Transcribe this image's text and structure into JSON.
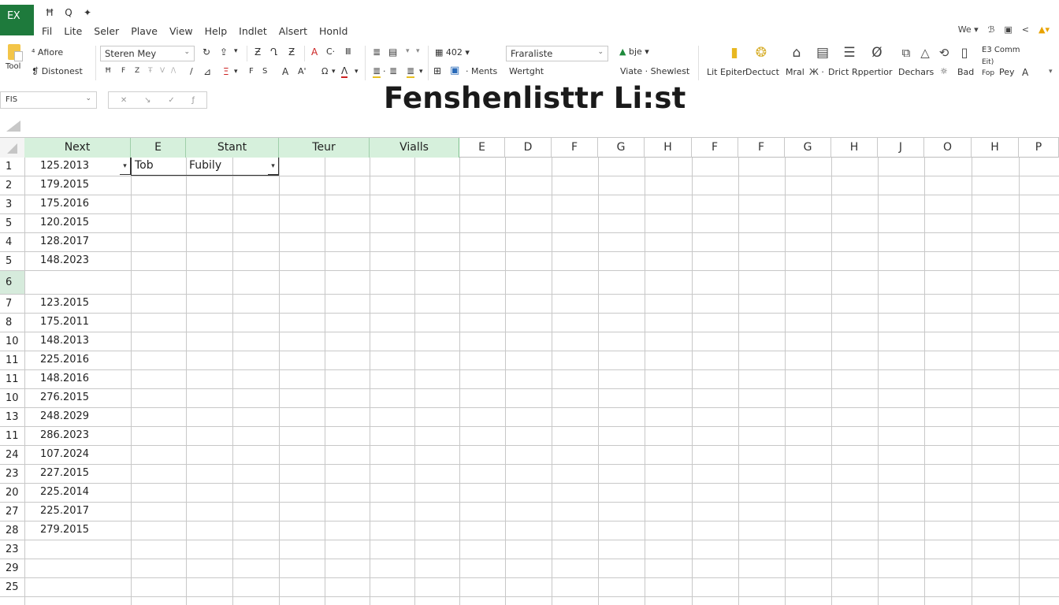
{
  "app": {
    "logo": "EX",
    "quick_access": [
      "save-icon",
      "search-icon",
      "pin-icon"
    ],
    "quick_access_glyphs": [
      "Ħ",
      "Q",
      "✦"
    ]
  },
  "menu": [
    "Fil",
    "Lite",
    "Seler",
    "Plave",
    "View",
    "Help",
    "Indlet",
    "Alsert",
    "Honld"
  ],
  "title_right": {
    "user_label": "We",
    "glyphs": [
      "ℬ",
      "▣",
      "<",
      "▲"
    ]
  },
  "ribbon": {
    "paste_label": "Tool",
    "clipboard": [
      "Afiore",
      "Distonest"
    ],
    "font_name": "Steren Mey",
    "row1_glyphs": [
      "↻",
      "⇪",
      "▾",
      "Ƶ",
      "Ղ",
      "Ƶ",
      "A",
      "C·",
      "Ⅲ"
    ],
    "row2_glyphs": [
      "Ħ",
      "F",
      "Z",
      "Ŧ",
      "V",
      "/\\",
      "/",
      "⊿",
      "Ξ",
      "▾",
      "F",
      "S",
      "A",
      "A'",
      "Ω",
      "▾",
      "Λ",
      "▾"
    ],
    "align_glyphs": [
      "≣",
      "▤",
      "▾",
      "▾",
      "≣",
      "·",
      "≣",
      "≣",
      "▾"
    ],
    "number_format": "402",
    "number_row2": [
      "⊞",
      "▣",
      "Ments"
    ],
    "style_combo": "Fraraliste",
    "style_label": "Wertght",
    "font_color_label": "bje",
    "sheet_label": "Viate · Shewlest",
    "right_labels": [
      "Lit",
      "Epiter",
      "Dectuct",
      "Mral",
      "Ж ·",
      "Drict",
      "Rppertior",
      "Dechars",
      "☼",
      "Bad",
      "Pey",
      "A"
    ],
    "right_top": [
      "E3 Comm",
      "Eit)",
      "Fop"
    ],
    "right_icons": [
      "folder-icon",
      "gear-user-icon",
      "home-icon",
      "document-icon",
      "card-icon",
      "globe-icon",
      "copy-icon",
      "triangle-icon",
      "refresh-icon",
      "file-icon"
    ],
    "right_glyphs": [
      "▮",
      "❂",
      "⌂",
      "▤",
      "☰",
      "Ø",
      "⧉",
      "△",
      "⟲",
      "▯"
    ]
  },
  "name_box": "FIS",
  "formula_bar_glyphs": [
    "✕",
    "↘",
    "✓",
    "ƒ"
  ],
  "sheet_title": "Fenshenlisttr Li:st",
  "columns": [
    "Next",
    "E",
    "Stant",
    "Teur",
    "Vialls",
    "E",
    "D",
    "F",
    "G",
    "H",
    "F",
    "F",
    "G",
    "H",
    "J",
    "O",
    "H",
    "P"
  ],
  "rows": [
    {
      "num": "1",
      "a": "125.2013",
      "b": "Tob",
      "c": "Fubily"
    },
    {
      "num": "2",
      "a": "179.2015"
    },
    {
      "num": "3",
      "a": "175.2016"
    },
    {
      "num": "5",
      "a": "120.2015"
    },
    {
      "num": "4",
      "a": "128.2017"
    },
    {
      "num": "5",
      "a": "148.2023"
    },
    {
      "num": "6",
      "a": ""
    },
    {
      "num": "7",
      "a": "123.2015"
    },
    {
      "num": "8",
      "a": "175.2011"
    },
    {
      "num": "10",
      "a": "148.2013"
    },
    {
      "num": "11",
      "a": "225.2016"
    },
    {
      "num": "11",
      "a": "148.2016"
    },
    {
      "num": "10",
      "a": "276.2015"
    },
    {
      "num": "13",
      "a": "248.2029"
    },
    {
      "num": "11",
      "a": "286.2023"
    },
    {
      "num": "24",
      "a": "107.2024"
    },
    {
      "num": "23",
      "a": "227.2015"
    },
    {
      "num": "20",
      "a": "225.2014"
    },
    {
      "num": "27",
      "a": "225.2017"
    },
    {
      "num": "28",
      "a": "279.2015"
    },
    {
      "num": "23",
      "a": ""
    },
    {
      "num": "29",
      "a": ""
    },
    {
      "num": "25",
      "a": ""
    }
  ],
  "selected_row": "6",
  "colors": {
    "accent": "#1e7a3c",
    "header_highlight": "#d6f0dc",
    "gridline": "#c8c8c8"
  }
}
